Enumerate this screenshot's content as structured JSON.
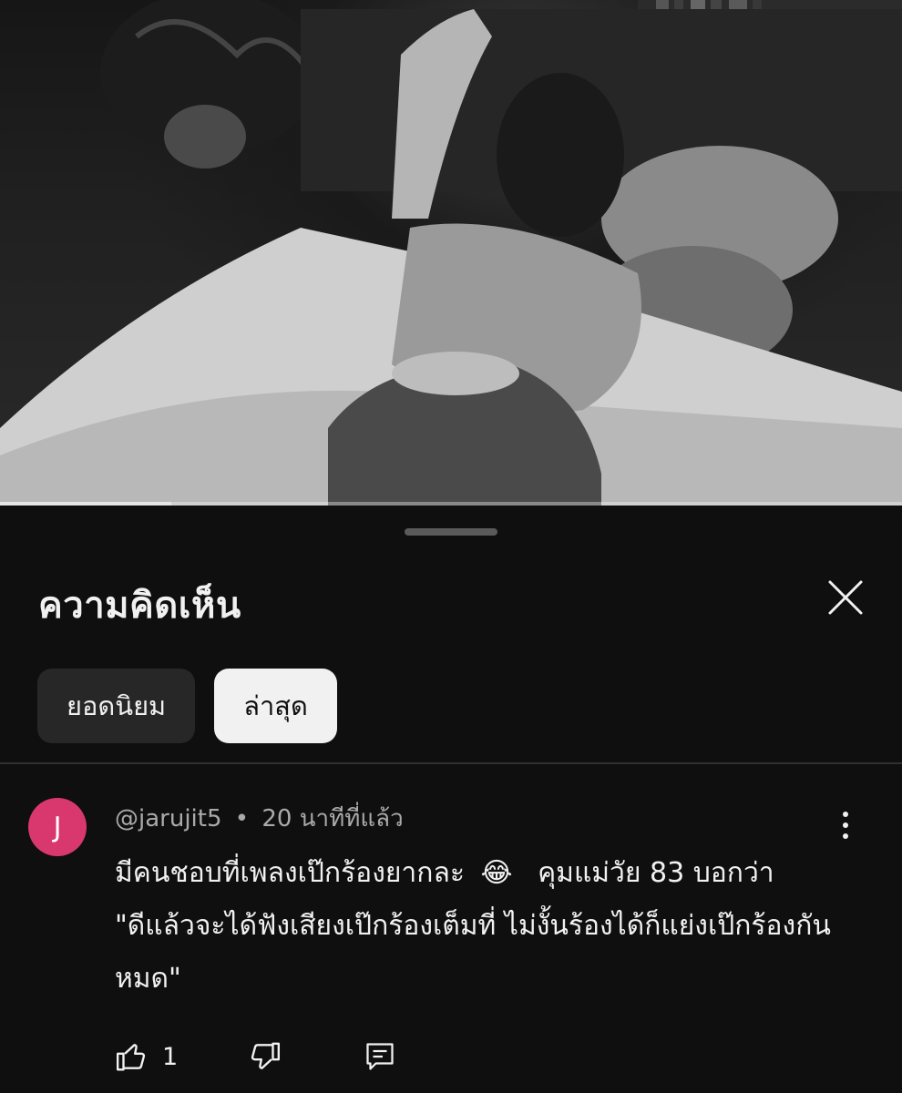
{
  "video": {
    "progress_fraction": 0.19
  },
  "sheet": {
    "title": "ความคิดเห็น"
  },
  "filters": {
    "top_label": "ยอดนิยม",
    "newest_label": "ล่าสุด",
    "selected": "ล่าสุด"
  },
  "comment": {
    "avatar_letter": "J",
    "avatar_color": "#d9386e",
    "author": "@jarujit5",
    "separator": "•",
    "time": "20 นาทีที่แล้ว",
    "text_part1": "มีคนชอบที่เพลงเป๊กร้องยากละ",
    "emoji": "😂",
    "text_part2": "คุมแม่วัย 83 บอกว่า \"ดีแล้วจะได้ฟังเสียงเป๊กร้องเต็มที่ ไม่งั้นร้องได้ก็แย่งเป๊กร้องกันหมด\"",
    "like_count": "1"
  },
  "icons": {
    "close": "close-icon",
    "more": "more-vert-icon",
    "like": "thumb-up-icon",
    "dislike": "thumb-down-icon",
    "reply": "reply-comment-icon"
  }
}
